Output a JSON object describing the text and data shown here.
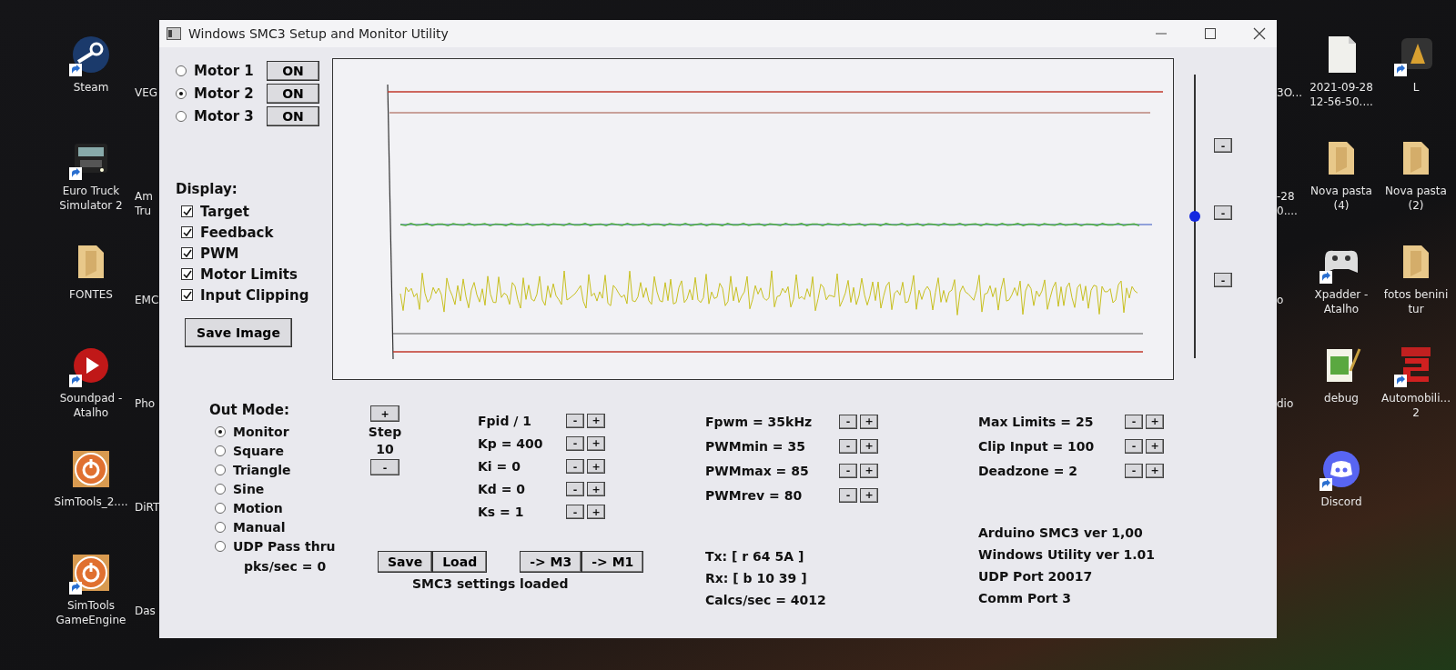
{
  "desktop": {
    "left_icons": [
      {
        "label": "Steam",
        "kind": "steam",
        "shortcut": true
      },
      {
        "label": "Euro Truck Simulator 2",
        "kind": "truck",
        "shortcut": true
      },
      {
        "label": "FONTES",
        "kind": "folder",
        "shortcut": false
      },
      {
        "label": "Soundpad - Atalho",
        "kind": "soundpad",
        "shortcut": true
      },
      {
        "label": "SimTools_2....",
        "kind": "simtools",
        "shortcut": false
      },
      {
        "label": "SimTools GameEngine",
        "kind": "simtools",
        "shortcut": true
      }
    ],
    "left_partial_labels": [
      "VEG",
      "Am Tru",
      "EMC",
      "Pho",
      "DiRT",
      "Das"
    ],
    "right_partial_labels": [
      "3O...",
      "-28 0....",
      "o",
      "dio"
    ],
    "right_icons": [
      {
        "label": "2021-09-28 12-56-50....",
        "kind": "file",
        "shortcut": false
      },
      {
        "label": "Nova pasta (4)",
        "kind": "folder",
        "shortcut": false
      },
      {
        "label": "Xpadder - Atalho",
        "kind": "gamepad",
        "shortcut": true
      },
      {
        "label": "debug",
        "kind": "notepad",
        "shortcut": false
      },
      {
        "label": "Discord",
        "kind": "discord",
        "shortcut": true
      }
    ],
    "far_right_icons": [
      {
        "label": "L",
        "kind": "game",
        "shortcut": true
      },
      {
        "label": "Nova pasta (2)",
        "kind": "folder",
        "shortcut": false
      },
      {
        "label": "fotos benini tur",
        "kind": "folder",
        "shortcut": false
      },
      {
        "label": "Automobili... 2",
        "kind": "ams",
        "shortcut": true
      }
    ]
  },
  "window": {
    "title": "Windows SMC3 Setup and Monitor Utility"
  },
  "motors": [
    {
      "label": "Motor 1",
      "selected": false,
      "button": "ON"
    },
    {
      "label": "Motor 2",
      "selected": true,
      "button": "ON"
    },
    {
      "label": "Motor 3",
      "selected": false,
      "button": "ON"
    }
  ],
  "display": {
    "label": "Display:",
    "options": [
      {
        "label": "Target",
        "checked": true
      },
      {
        "label": "Feedback",
        "checked": true
      },
      {
        "label": "PWM",
        "checked": true
      },
      {
        "label": "Motor Limits",
        "checked": true
      },
      {
        "label": "Input Clipping",
        "checked": true
      }
    ],
    "save_button": "Save Image"
  },
  "monitor": {
    "slider": {
      "level": 0.5
    },
    "scale_buttons": [
      "-",
      "-",
      "-"
    ]
  },
  "out_mode": {
    "label": "Out Mode:",
    "options": [
      {
        "label": "Monitor",
        "selected": true
      },
      {
        "label": "Square",
        "selected": false
      },
      {
        "label": "Triangle",
        "selected": false
      },
      {
        "label": "Sine",
        "selected": false
      },
      {
        "label": "Motion",
        "selected": false
      },
      {
        "label": "Manual",
        "selected": false
      },
      {
        "label": "UDP Pass thru",
        "selected": false
      }
    ],
    "pks": "pks/sec = 0"
  },
  "step": {
    "increase": "+",
    "label": "Step",
    "value": "10",
    "decrease": "-"
  },
  "pid_params": [
    {
      "label": "Fpid / 1",
      "dec": "-",
      "inc": "+"
    },
    {
      "label": "Kp = 400",
      "dec": "-",
      "inc": "+"
    },
    {
      "label": "Ki = 0",
      "dec": "-",
      "inc": "+"
    },
    {
      "label": "Kd = 0",
      "dec": "-",
      "inc": "+"
    },
    {
      "label": "Ks = 1",
      "dec": "-",
      "inc": "+"
    }
  ],
  "pwm_params": [
    {
      "label": "Fpwm = 35kHz",
      "dec": "-",
      "inc": "+"
    },
    {
      "label": "PWMmin = 35",
      "dec": "-",
      "inc": "+"
    },
    {
      "label": "PWMmax = 85",
      "dec": "-",
      "inc": "+"
    },
    {
      "label": "PWMrev = 80",
      "dec": "-",
      "inc": "+"
    }
  ],
  "limit_params": [
    {
      "label": "Max Limits = 25",
      "dec": "-",
      "inc": "+"
    },
    {
      "label": "Clip Input = 100",
      "dec": "-",
      "inc": "+"
    },
    {
      "label": "Deadzone = 2",
      "dec": "-",
      "inc": "+"
    }
  ],
  "file_buttons": [
    "Save",
    "Load"
  ],
  "copy_buttons": [
    "-> M3",
    "-> M1"
  ],
  "status": "SMC3 settings loaded",
  "comm": [
    "Tx: [ r 64 5A ]",
    "Rx: [ b 10 39 ]",
    "Calcs/sec = 4012"
  ],
  "info": [
    "Arduino SMC3 ver 1,00",
    "Windows Utility ver 1.01",
    "UDP Port 20017",
    "Comm Port 3"
  ]
}
